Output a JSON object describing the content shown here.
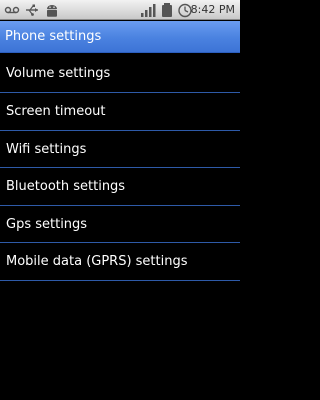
{
  "status_bar": {
    "time": "8:42 PM",
    "icons": [
      "voicemail-icon",
      "usb-icon",
      "android-debug-icon",
      "signal-icon",
      "battery-icon",
      "alarm-icon"
    ]
  },
  "header": {
    "title": "Phone settings"
  },
  "menu": {
    "items": [
      {
        "label": "Volume settings"
      },
      {
        "label": "Screen timeout"
      },
      {
        "label": "Wifi settings"
      },
      {
        "label": "Bluetooth settings"
      },
      {
        "label": "Gps settings"
      },
      {
        "label": "Mobile data (GPRS) settings"
      }
    ]
  },
  "colors": {
    "title_bar": "#4a82e0",
    "divider": "#2e5aa8",
    "background": "#000000",
    "text": "#ffffff"
  }
}
